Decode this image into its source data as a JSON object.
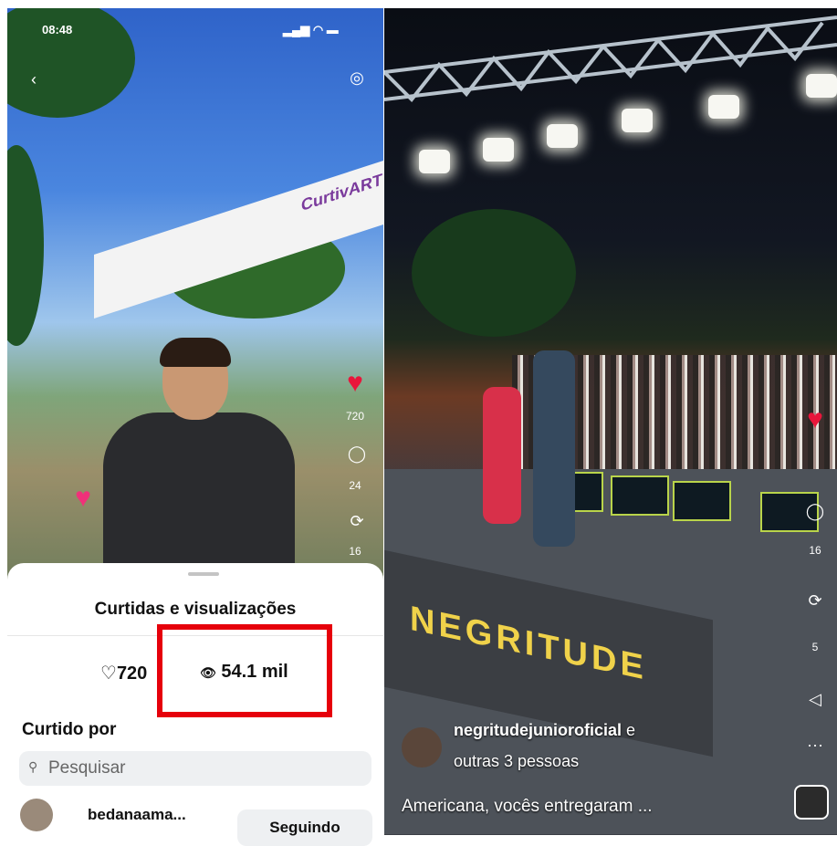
{
  "left": {
    "status_bar": {
      "time": "08:48"
    },
    "back_icon": "chevron-left-icon",
    "camera_icon": "camera-icon",
    "banner_text": "CurtivART",
    "side": {
      "likes": "720",
      "comments": "24",
      "reposts": "16"
    },
    "sheet": {
      "title": "Curtidas e visualizações",
      "likes_count": "720",
      "views_count": "54.1 mil",
      "liked_by_label": "Curtido por",
      "search_placeholder": "Pesquisar",
      "user": {
        "name": "bedanaama...",
        "button_label": "Seguindo"
      }
    },
    "highlight_color": "#e6000b"
  },
  "right": {
    "side": {
      "comments": "16",
      "reposts": "5"
    },
    "sign_text": "NEGRITUDE",
    "caption": {
      "user": "negritudejunioroficial",
      "user_suffix": "e",
      "others": "outras 3 pessoas",
      "text": "Americana, vocês entregaram ..."
    }
  },
  "colors": {
    "like_red": "#e8163b",
    "sheet_bg": "#ffffff",
    "search_bg": "#eef0f2"
  }
}
